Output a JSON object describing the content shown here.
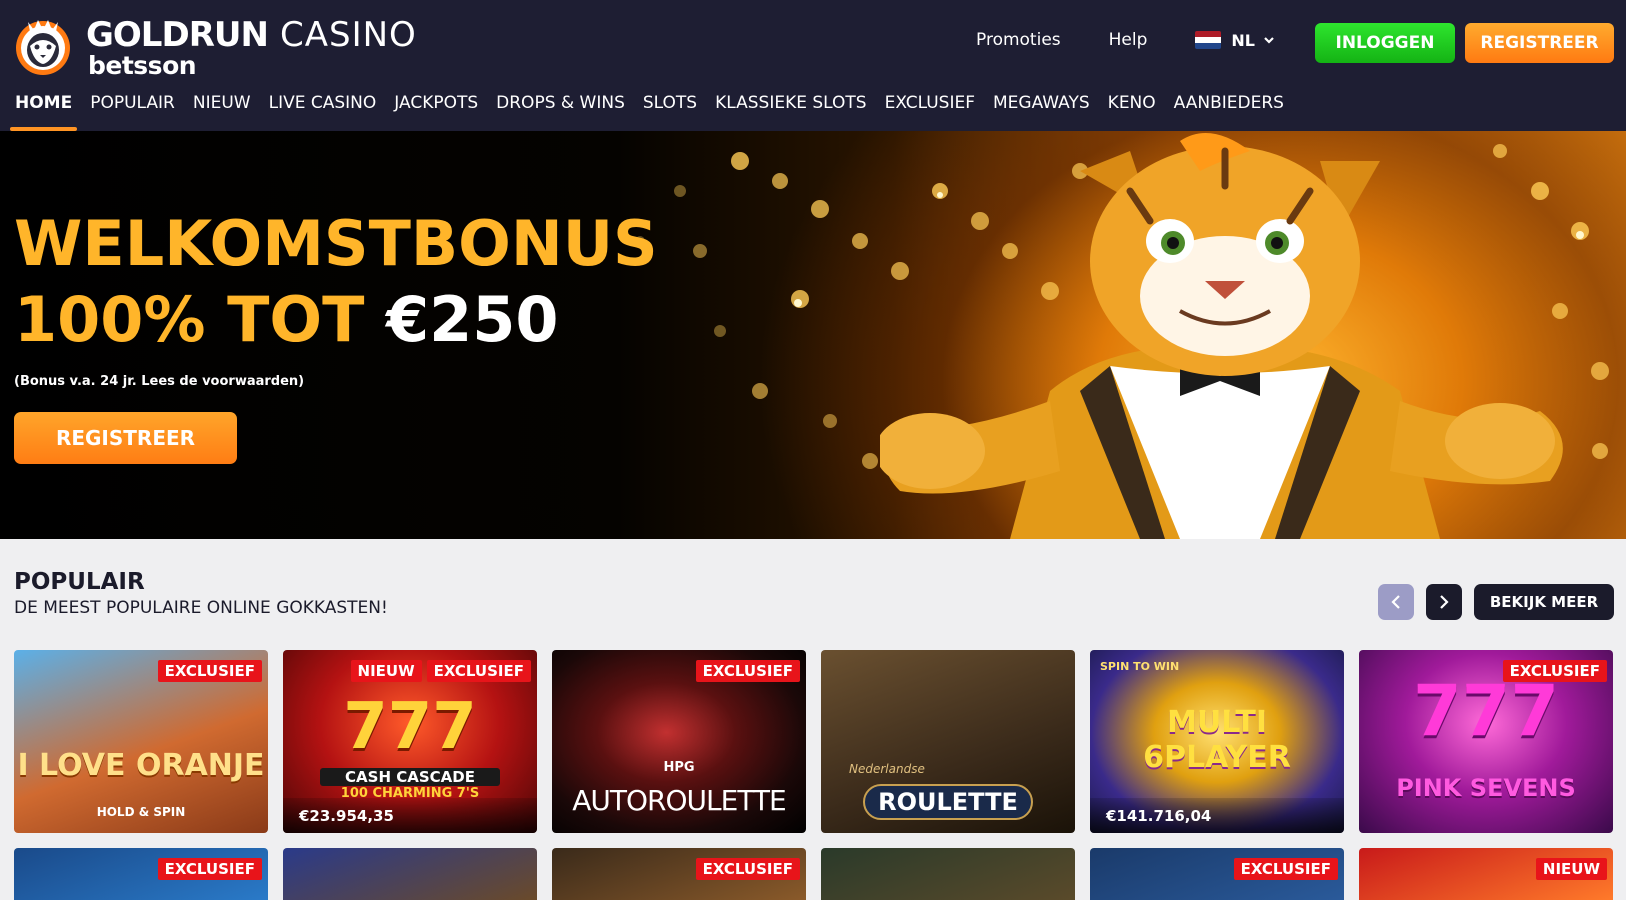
{
  "header": {
    "logo_main": "GOLDRUN",
    "logo_casino": "CASINO",
    "logo_sub": "betsson",
    "links": {
      "promoties": "Promoties",
      "help": "Help"
    },
    "lang": "NL",
    "login_label": "INLOGGEN",
    "register_label": "REGISTREER"
  },
  "nav": {
    "home": "HOME",
    "populair": "POPULAIR",
    "nieuw": "NIEUW",
    "live_casino": "LIVE CASINO",
    "jackpots": "JACKPOTS",
    "drops_wins": "DROPS & WINS",
    "slots": "SLOTS",
    "klassieke_slots": "KLASSIEKE SLOTS",
    "exclusief": "EXCLUSIEF",
    "megaways": "MEGAWAYS",
    "keno": "KENO",
    "aanbieders": "AANBIEDERS"
  },
  "hero": {
    "title_line1": "WELKOMSTBONUS",
    "title_line2_prefix": "100% TOT ",
    "title_line2_amount": "€250",
    "terms": "(Bonus v.a. 24 jr. Lees de voorwaarden)",
    "cta": "REGISTREER"
  },
  "section": {
    "title": "POPULAIR",
    "subtitle": "DE MEEST POPULAIRE ONLINE GOKKASTEN!",
    "more_label": "BEKIJK MEER"
  },
  "tiles_row1": [
    {
      "badges": [
        "EXCLUSIEF"
      ],
      "art_title": "I LOVE ORANJE",
      "art_sub": "HOLD & SPIN"
    },
    {
      "badges": [
        "NIEUW",
        "EXCLUSIEF"
      ],
      "art_title": "CASH CASCADE",
      "art_sub": "100 CHARMING 7'S",
      "jackpot": "€23.954,35"
    },
    {
      "badges": [
        "EXCLUSIEF"
      ],
      "art_title": "AUTOROULETTE",
      "art_sub": "HPG"
    },
    {
      "badges": [],
      "art_title": "ROULETTE",
      "art_sub": "Nederlandse"
    },
    {
      "badges": [],
      "art_title": "MULTI 6PLAYER",
      "art_sub": "SPIN TO WIN",
      "jackpot": "€141.716,04"
    },
    {
      "badges": [
        "EXCLUSIEF"
      ],
      "art_title": "PINK SEVENS",
      "art_sub": "777"
    }
  ],
  "tiles_row2": [
    {
      "badges": [
        "EXCLUSIEF"
      ]
    },
    {
      "badges": []
    },
    {
      "badges": [
        "EXCLUSIEF"
      ]
    },
    {
      "badges": []
    },
    {
      "badges": [
        "EXCLUSIEF"
      ]
    },
    {
      "badges": [
        "NIEUW"
      ]
    }
  ],
  "colors": {
    "header_bg": "#1e1e33",
    "accent_orange": "#ff8c1e",
    "login_green": "#22cc22",
    "badge_red": "#e8141a",
    "hero_gold": "#ffb52a"
  },
  "icons": [
    "tiger-logo-icon",
    "nl-flag-icon",
    "chevron-down-icon",
    "chevron-left-icon",
    "chevron-right-icon"
  ]
}
